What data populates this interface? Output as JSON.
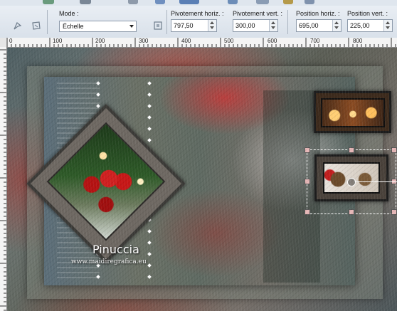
{
  "toolbar": {
    "mode_label": "Mode :",
    "mode_value": "Échelle",
    "pivot_h_label": "Pivotement horiz. :",
    "pivot_h_value": "797,50",
    "pivot_v_label": "Pivotement vert. :",
    "pivot_v_value": "300,00",
    "pos_h_label": "Position horiz. :",
    "pos_h_value": "695,00",
    "pos_v_label": "Position vert. :",
    "pos_v_value": "225,00"
  },
  "ruler": {
    "ticks": [
      "0",
      "100",
      "200",
      "300",
      "400",
      "500",
      "600",
      "700",
      "800"
    ]
  },
  "canvas": {
    "watermark_title": "Pinuccia",
    "watermark_url": "www.maidiregrafica.eu"
  },
  "icons": [
    "pick-tool-icon",
    "deform-icon",
    "dropdown-arrow-icon",
    "center-pivot-icon",
    "spin-up-icon",
    "spin-down-icon"
  ]
}
